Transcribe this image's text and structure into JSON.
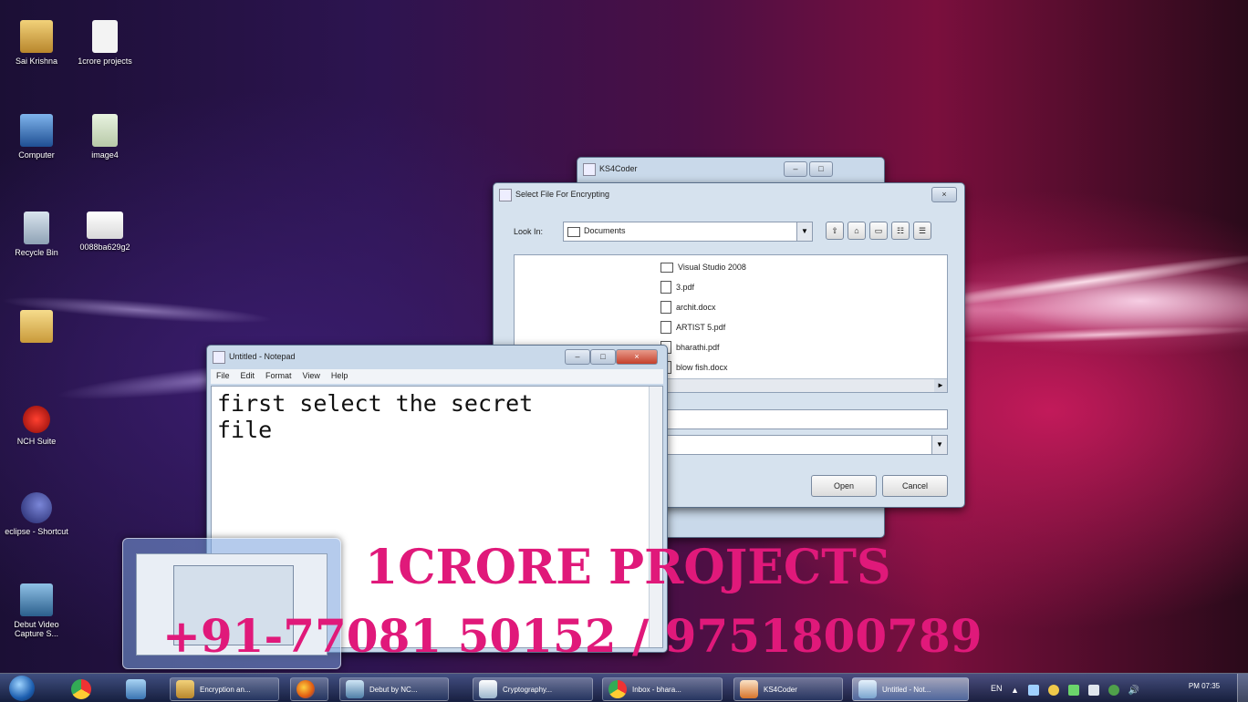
{
  "desktop_icons": [
    {
      "label": "Sai Krishna",
      "icon": "user-folder-icon"
    },
    {
      "label": "1crore projects",
      "icon": "file-icon"
    },
    {
      "label": "Computer",
      "icon": "computer-icon"
    },
    {
      "label": "image4",
      "icon": "image-file-icon"
    },
    {
      "label": "Recycle Bin",
      "icon": "recycle-bin-icon"
    },
    {
      "label": "0088ba629g2",
      "icon": "image-file-icon"
    },
    {
      "label": "",
      "icon": "folder-icon"
    },
    {
      "label": "NCH Suite",
      "icon": "nch-suite-icon"
    },
    {
      "label": "eclipse - Shortcut",
      "icon": "eclipse-icon"
    },
    {
      "label": "Debut Video Capture S...",
      "icon": "debut-video-icon"
    }
  ],
  "kscoder_window": {
    "title": "KS4Coder"
  },
  "file_dialog": {
    "title": "Select File For Encrypting",
    "look_in_label": "Look In:",
    "look_in_value": "Documents",
    "files": [
      {
        "name": "Visual Studio 2008",
        "type": "folder"
      },
      {
        "name": "3.pdf",
        "type": "file"
      },
      {
        "name": "archit.docx",
        "type": "file"
      },
      {
        "name": "ARTIST 5.pdf",
        "type": "file"
      },
      {
        "name": "bharathi.pdf",
        "type": "file"
      },
      {
        "name": "blow fish.docx",
        "type": "file"
      }
    ],
    "open_label": "Open",
    "cancel_label": "Cancel"
  },
  "notepad": {
    "title": "Untitled - Notepad",
    "menu": [
      "File",
      "Edit",
      "Format",
      "View",
      "Help"
    ],
    "content": "first select the secret\nfile"
  },
  "watermark": {
    "line1": "1CRORE PROJECTS",
    "line2": "+91-77081 50152 / 9751800789",
    "color": "#e0197a"
  },
  "taskbar": {
    "items": [
      {
        "label": "Encryption an...",
        "icon": "folder-app-icon"
      },
      {
        "label": "",
        "icon": "firefox-icon"
      },
      {
        "label": "Debut by NC...",
        "icon": "debut-app-icon"
      },
      {
        "label": "Cryptography...",
        "icon": "cryptography-icon"
      },
      {
        "label": "Inbox - bhara...",
        "icon": "chrome-icon"
      },
      {
        "label": "KS4Coder",
        "icon": "java-icon"
      },
      {
        "label": "Untitled - Not...",
        "icon": "notepad-icon"
      }
    ],
    "lang": "EN",
    "clock_time": "PM 07:35"
  }
}
